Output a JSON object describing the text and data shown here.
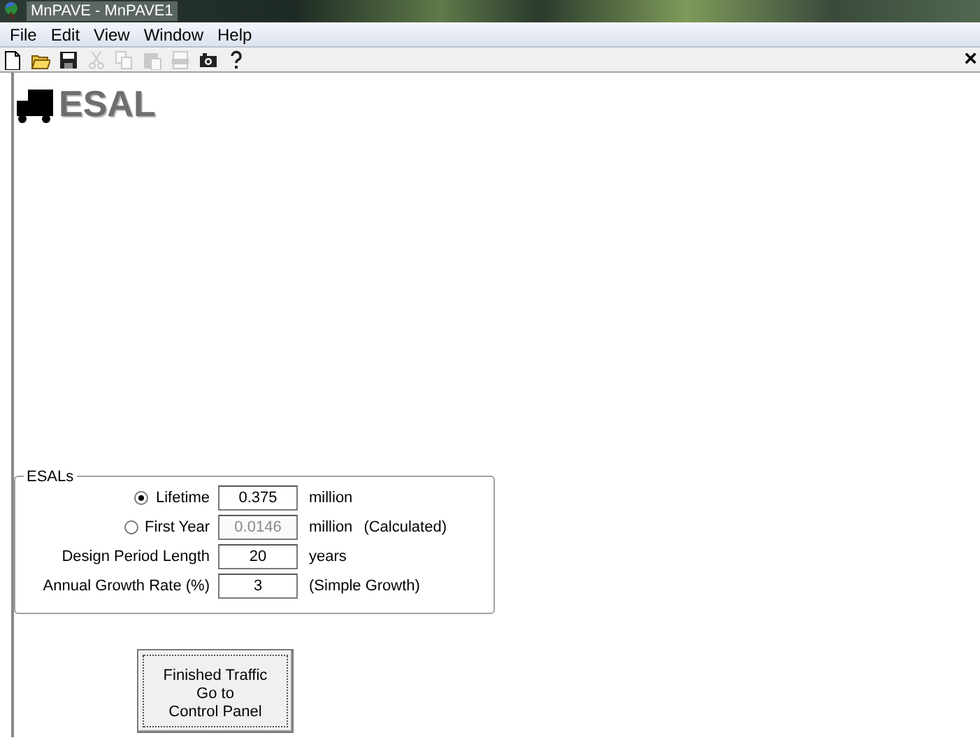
{
  "window": {
    "title": "MnPAVE - MnPAVE1"
  },
  "menu": [
    "File",
    "Edit",
    "View",
    "Window",
    "Help"
  ],
  "toolbar": [
    {
      "kind": "new",
      "disabled": false
    },
    {
      "kind": "open",
      "disabled": false
    },
    {
      "kind": "save",
      "disabled": false
    },
    {
      "kind": "cut",
      "disabled": true
    },
    {
      "kind": "copy",
      "disabled": true
    },
    {
      "kind": "paste",
      "disabled": true
    },
    {
      "kind": "pdf",
      "disabled": true
    },
    {
      "kind": "camera",
      "disabled": false
    },
    {
      "kind": "help",
      "disabled": false
    }
  ],
  "close": "×",
  "heading": "ESAL",
  "esals": {
    "title": "ESALs",
    "rows": [
      {
        "kind": "radio",
        "label": "Lifetime",
        "selected": true,
        "value": "0.375",
        "disabled": false,
        "unit": "million"
      },
      {
        "kind": "radio",
        "label": "First Year",
        "selected": false,
        "value": "0.0146",
        "disabled": true,
        "unit": "million",
        "note": "(Calculated)"
      },
      {
        "kind": "plain",
        "label": "Design Period Length",
        "value": "20",
        "disabled": false,
        "unit": "years"
      },
      {
        "kind": "plain",
        "label": "Annual Growth Rate (%)",
        "value": "3",
        "disabled": false,
        "note": "(Simple Growth)"
      }
    ]
  },
  "button": "Finished Traffic\nGo to\nControl Panel"
}
